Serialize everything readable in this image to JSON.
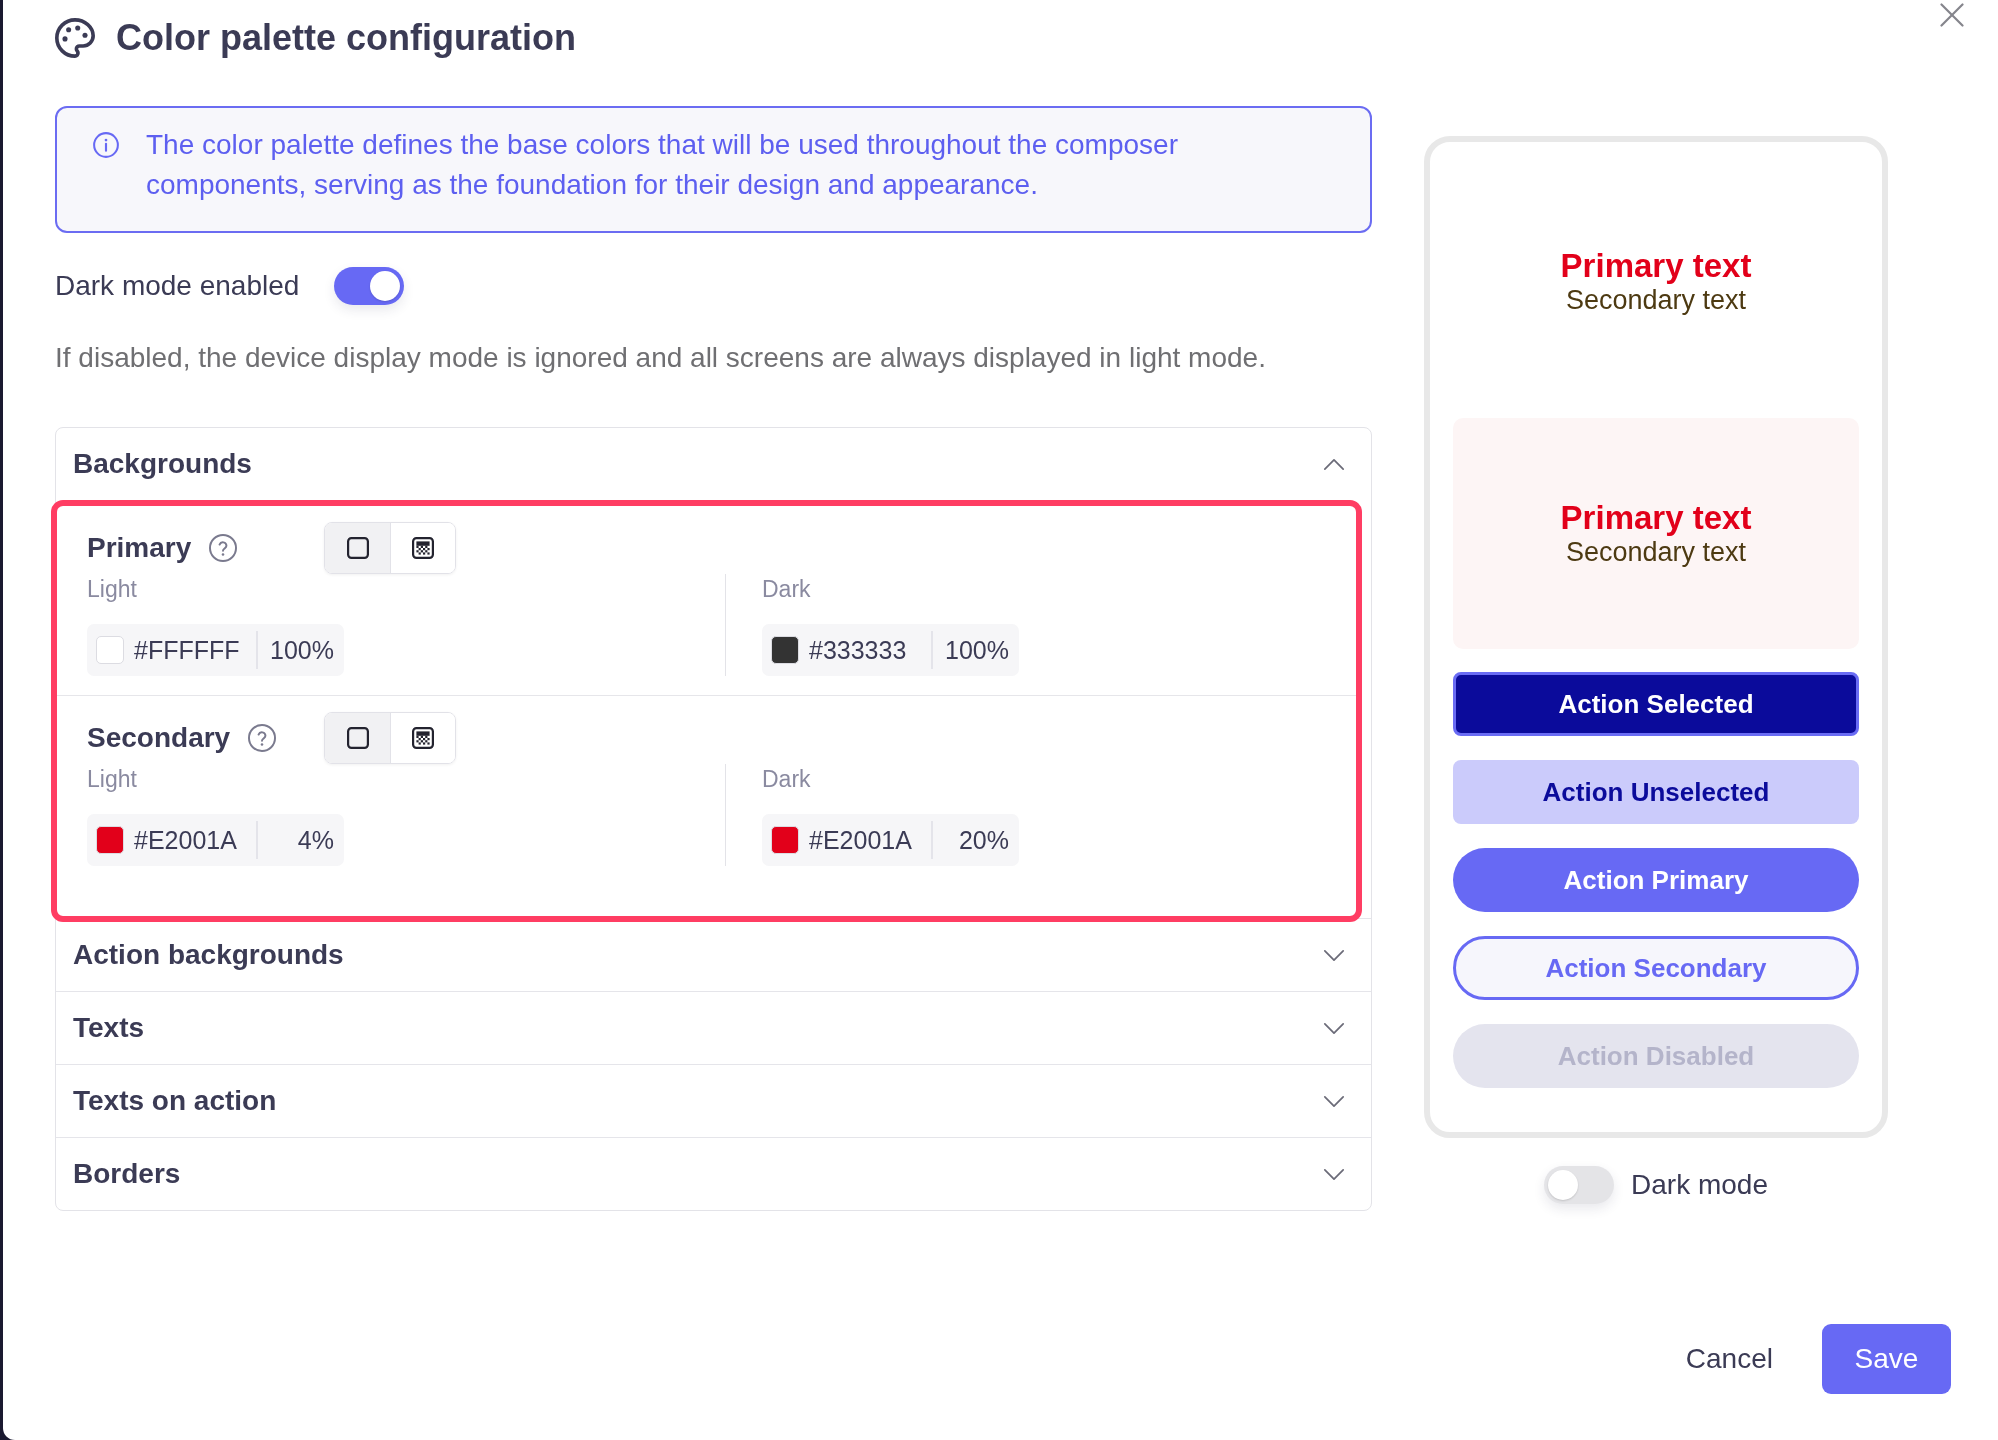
{
  "dialog": {
    "title": "Color palette configuration"
  },
  "info_banner": {
    "text": "The color palette defines the base colors that will be used throughout the composer components, serving as the foundation for their design and appearance."
  },
  "dark_mode_setting": {
    "label": "Dark mode enabled",
    "on": true,
    "description": "If disabled, the device display mode is ignored and all screens are always displayed in light mode."
  },
  "sections": [
    {
      "title": "Backgrounds",
      "expanded": true,
      "highlighted": true,
      "colors": [
        {
          "name": "Primary",
          "fill_types": [
            {
              "kind": "solid",
              "selected": true
            },
            {
              "kind": "gradient",
              "selected": false
            }
          ],
          "variants": [
            {
              "label": "Light",
              "hex": "#FFFFFF",
              "opacity": "100%",
              "color": "#ffffff"
            },
            {
              "label": "Dark",
              "hex": "#333333",
              "opacity": "100%",
              "color": "#333333"
            }
          ]
        },
        {
          "name": "Secondary",
          "fill_types": [
            {
              "kind": "solid",
              "selected": true
            },
            {
              "kind": "gradient",
              "selected": false
            }
          ],
          "variants": [
            {
              "label": "Light",
              "hex": "#E2001A",
              "opacity": "4%",
              "color": "#e2001a"
            },
            {
              "label": "Dark",
              "hex": "#E2001A",
              "opacity": "20%",
              "color": "#e2001a"
            }
          ]
        }
      ]
    },
    {
      "title": "Action backgrounds",
      "expanded": false
    },
    {
      "title": "Texts",
      "expanded": false
    },
    {
      "title": "Texts on action",
      "expanded": false
    },
    {
      "title": "Borders",
      "expanded": false
    }
  ],
  "preview": {
    "surfaces": [
      {
        "kind": "primary",
        "primary_text": "Primary text",
        "secondary_text": "Secondary text"
      },
      {
        "kind": "secondary",
        "primary_text": "Primary text",
        "secondary_text": "Secondary text"
      }
    ],
    "actions": [
      {
        "kind": "selected",
        "label": "Action Selected"
      },
      {
        "kind": "unselected",
        "label": "Action Unselected"
      },
      {
        "kind": "primary",
        "label": "Action Primary"
      },
      {
        "kind": "secondary",
        "label": "Action Secondary"
      },
      {
        "kind": "disabled",
        "label": "Action Disabled"
      }
    ],
    "dark_mode": {
      "label": "Dark mode",
      "on": false
    }
  },
  "footer": {
    "buttons": [
      {
        "kind": "secondary",
        "label": "Cancel"
      },
      {
        "kind": "primary",
        "label": "Save"
      }
    ]
  }
}
